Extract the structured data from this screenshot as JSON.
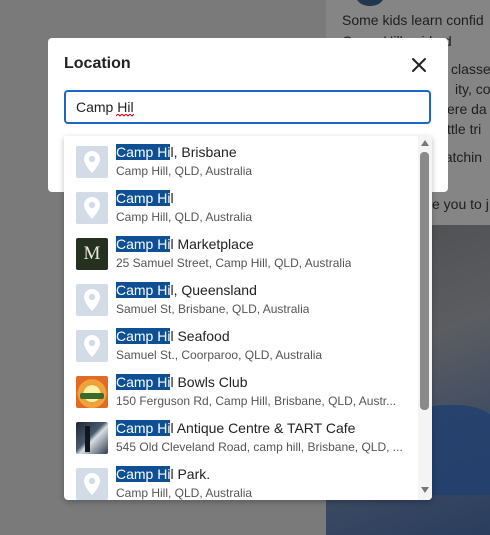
{
  "background": {
    "text_lines": [
      "Some kids learn confid",
      "Camp Hill pside d",
      "classe",
      "ity, coo",
      "ere da",
      "ttle tri",
      "Watchin",
      "e you to j"
    ]
  },
  "modal": {
    "title": "Location",
    "search_value": "Camp Hil",
    "accent_color": "#1a66c9",
    "highlight_color": "#0f4f94"
  },
  "suggestions": [
    {
      "match": "Camp Hi",
      "rest": "l, Brisbane",
      "address": "Camp Hill, QLD, Australia",
      "icon": "map-pin-icon"
    },
    {
      "match": "Camp Hi",
      "rest": "l",
      "address": "Camp Hill, QLD, Australia",
      "icon": "map-pin-icon"
    },
    {
      "match": "Camp Hi",
      "rest": "l Marketplace",
      "address": "25 Samuel Street, Camp Hill, QLD, Australia",
      "icon": "marketplace-logo",
      "logo_letter": "M"
    },
    {
      "match": "Camp Hi",
      "rest": "l, Queensland",
      "address": "Samuel St, Brisbane, QLD, Australia",
      "icon": "map-pin-icon"
    },
    {
      "match": "Camp Hi",
      "rest": "l Seafood",
      "address": "Samuel St., Coorparoo, QLD, Australia",
      "icon": "map-pin-icon"
    },
    {
      "match": "Camp Hi",
      "rest": "l Bowls Club",
      "address": "150 Ferguson Rd, Camp Hill, Brisbane, QLD, Austr...",
      "icon": "bowls-club-logo"
    },
    {
      "match": "Camp Hi",
      "rest": "l Antique Centre & TART Cafe",
      "address": "545 Old Cleveland Road, camp hill, Brisbane, QLD, ...",
      "icon": "cafe-photo"
    },
    {
      "match": "Camp Hi",
      "rest": "l Park.",
      "address": "Camp Hill, QLD, Australia",
      "icon": "map-pin-icon"
    }
  ]
}
